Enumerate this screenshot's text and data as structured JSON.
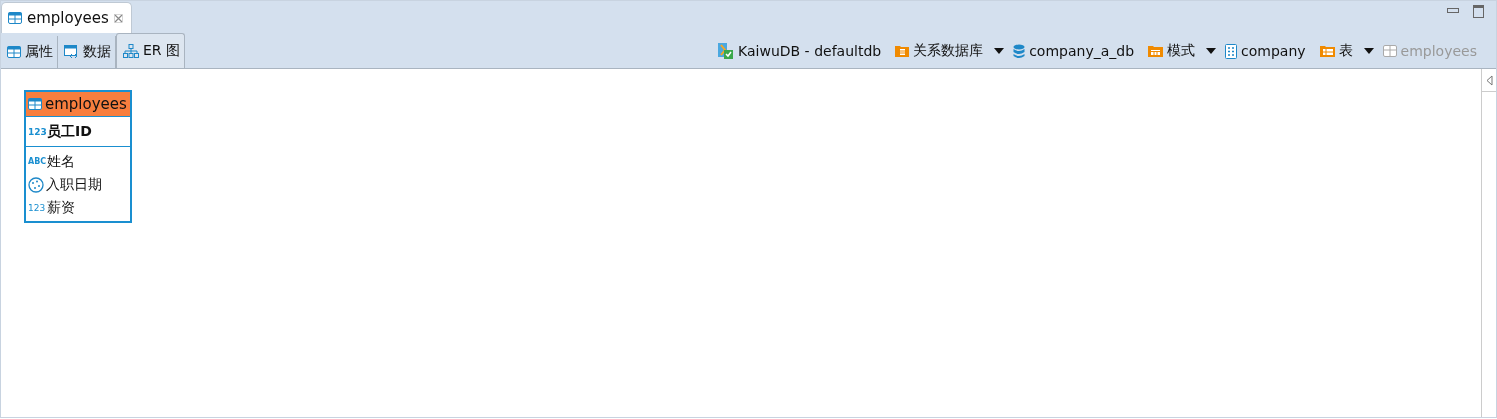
{
  "editor_tab": {
    "title": "employees",
    "selected": true
  },
  "sub_tabs": [
    {
      "label": "属性",
      "kind": "table",
      "selected": false
    },
    {
      "label": "数据",
      "kind": "data",
      "selected": false
    },
    {
      "label": "ER 图",
      "kind": "er",
      "selected": true
    }
  ],
  "breadcrumb": [
    {
      "label": "KaiwuDB - defaultdb",
      "kind": "connection",
      "dropdown": false,
      "disabled": false
    },
    {
      "label": "关系数据库",
      "kind": "folder-db",
      "dropdown": true,
      "disabled": false
    },
    {
      "label": "company_a_db",
      "kind": "database",
      "dropdown": false,
      "disabled": false
    },
    {
      "label": "模式",
      "kind": "folder-schema",
      "dropdown": true,
      "disabled": false
    },
    {
      "label": "company",
      "kind": "schema",
      "dropdown": false,
      "disabled": false
    },
    {
      "label": "表",
      "kind": "folder-table",
      "dropdown": true,
      "disabled": false
    },
    {
      "label": "employees",
      "kind": "table",
      "dropdown": false,
      "disabled": true
    }
  ],
  "entity": {
    "name": "employees",
    "key_columns": [
      {
        "name": "员工ID",
        "kind": "number",
        "type_text": "123"
      }
    ],
    "columns": [
      {
        "name": "姓名",
        "kind": "string",
        "type_text": "ABC"
      },
      {
        "name": "入职日期",
        "kind": "date"
      },
      {
        "name": "薪资",
        "kind": "number",
        "type_text": "123"
      }
    ]
  }
}
